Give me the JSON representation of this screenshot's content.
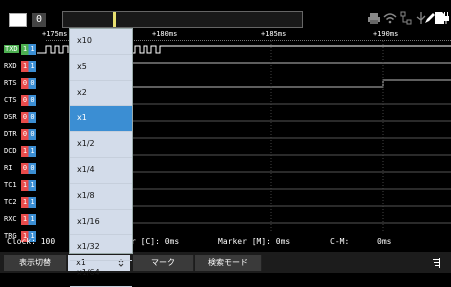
{
  "topbar": {
    "counter": "0"
  },
  "time_labels": [
    "+175ms",
    "+180ms",
    "+185ms",
    "+190ms"
  ],
  "signals": [
    {
      "name": "TXD",
      "value": "1 1",
      "color": "#4caf50"
    },
    {
      "name": "RXD",
      "value": "1 1",
      "color": "#e84b4b"
    },
    {
      "name": "RTS",
      "value": "0 0",
      "color": "#e84b4b"
    },
    {
      "name": "CTS",
      "value": "0 0",
      "color": "#e84b4b"
    },
    {
      "name": "DSR",
      "value": "0 0",
      "color": "#e84b4b"
    },
    {
      "name": "DTR",
      "value": "0 0",
      "color": "#e84b4b"
    },
    {
      "name": "DCD",
      "value": "1 1",
      "color": "#e84b4b"
    },
    {
      "name": "RI",
      "value": "0 0",
      "color": "#e84b4b"
    },
    {
      "name": "TC1",
      "value": "1 1",
      "color": "#e84b4b"
    },
    {
      "name": "TC2",
      "value": "1 1",
      "color": "#e84b4b"
    },
    {
      "name": "RXC",
      "value": "1 1",
      "color": "#e84b4b"
    },
    {
      "name": "TRG",
      "value": "1 1",
      "color": "#e84b4b"
    }
  ],
  "footer": {
    "clock": "Clock:  100",
    "cursor": "r [C]: 0ms",
    "marker": "Marker [M]: 0ms",
    "cm_label": "C-M:",
    "cm_value": "0ms"
  },
  "bottombar": {
    "display_switch": "表示切替",
    "zoom_value": "x1",
    "mark": "マーク",
    "search_mode": "検索モード"
  },
  "zoom_options": [
    "x10",
    "x5",
    "x2",
    "x1",
    "x1/2",
    "x1/4",
    "x1/8",
    "x1/16",
    "x1/32",
    "x1/64"
  ],
  "zoom_selected": "x1"
}
